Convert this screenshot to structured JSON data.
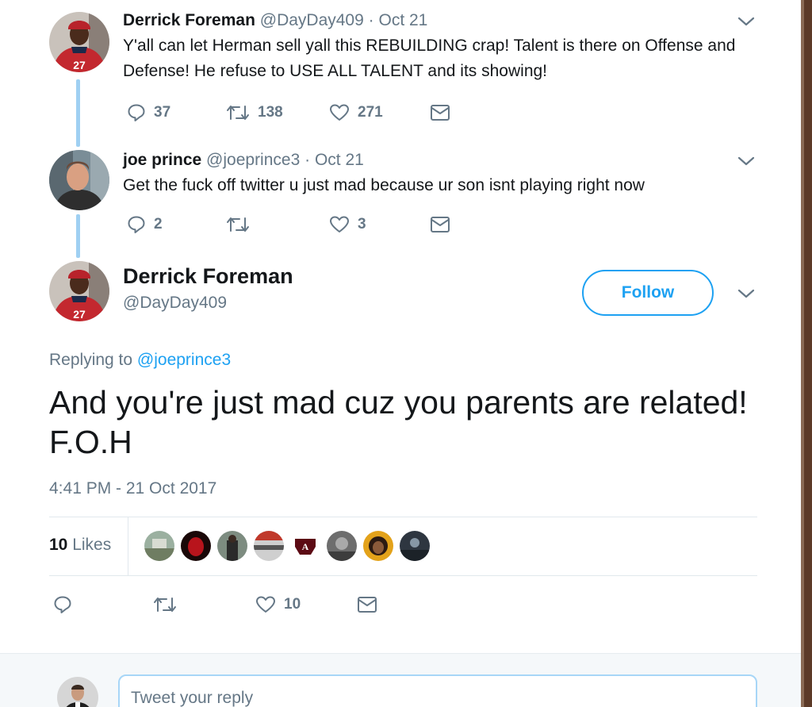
{
  "thread": [
    {
      "name": "Derrick Foreman",
      "handle": "@DayDay409",
      "sep": "·",
      "date": "Oct 21",
      "text": "Y'all can let Herman sell yall this REBUILDING crap! Talent is there on Offense and Defense! He refuse to USE ALL TALENT and its showing!",
      "replies": "37",
      "retweets": "138",
      "likes": "271"
    },
    {
      "name": "joe prince",
      "handle": "@joeprince3",
      "sep": "·",
      "date": "Oct 21",
      "text": "Get the fuck off twitter u just mad because ur son isnt playing right now",
      "replies": "2",
      "retweets": "",
      "likes": "3"
    }
  ],
  "main": {
    "name": "Derrick Foreman",
    "handle": "@DayDay409",
    "follow_label": "Follow",
    "replying_prefix": "Replying to",
    "replying_handle": "@joeprince3",
    "text": "And you're just mad cuz you parents are related! F.O.H",
    "timestamp": "4:41 PM - 21 Oct 2017",
    "likes_number": "10",
    "likes_word": "Likes",
    "like_count": "10"
  },
  "reply": {
    "placeholder": "Tweet your reply"
  },
  "colors": {
    "accent": "#1da1f2",
    "muted": "#657786",
    "thread_line": "#9fd0f2"
  },
  "icons": [
    "reply-icon",
    "retweet-icon",
    "heart-icon",
    "direct-message-icon",
    "chevron-down-icon"
  ]
}
